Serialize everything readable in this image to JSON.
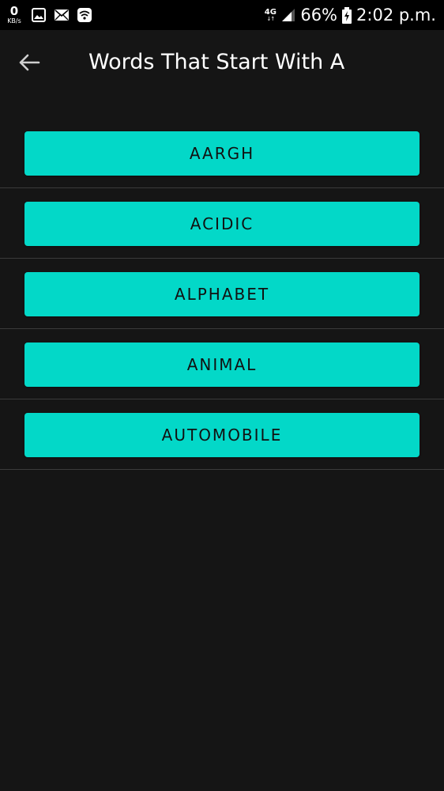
{
  "status_bar": {
    "data_speed_value": "0",
    "data_speed_unit": "KB/s",
    "network_type": "4G",
    "network_arrows": "↓↑",
    "battery_percent": "66%",
    "time": "2:02 p.m.",
    "icons": [
      "gallery-icon",
      "mail-icon",
      "wifi-icon",
      "signal-icon",
      "battery-charging-icon"
    ]
  },
  "toolbar": {
    "back_icon": "arrow-back-icon",
    "title": "Words That Start With A"
  },
  "words": [
    "AARGH",
    "ACIDIC",
    "ALPHABET",
    "ANIMAL",
    "AUTOMOBILE"
  ],
  "colors": {
    "background": "#151515",
    "status_bar": "#000000",
    "button": "#03d8c8",
    "button_text": "#111111",
    "divider": "#3b3b3b",
    "title_text": "#ffffff"
  }
}
